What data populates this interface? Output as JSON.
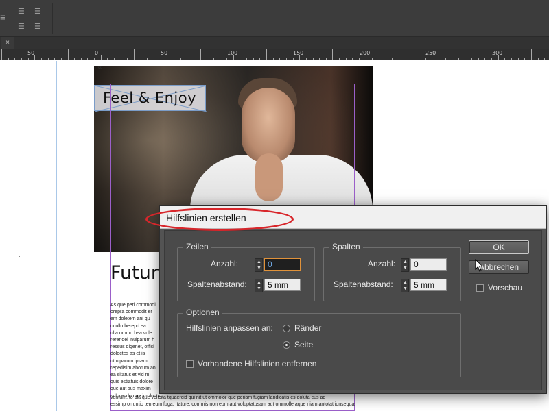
{
  "ruler": {
    "labels": [
      "50",
      "0",
      "50",
      "100",
      "150",
      "200",
      "250",
      "300"
    ]
  },
  "tab": {
    "close_glyph": "×"
  },
  "document": {
    "headline": "Feel & Enjoy",
    "subheading": "Future",
    "body_lines": [
      "As que peri commodi",
      "orepra commodit er",
      "em doletem ani qu",
      "ocullo berepd ea",
      "ulla ommo bea vole",
      "rerendel inulparum h",
      "ressus digenet, offici",
      "doloctes as et is",
      "ut ulparum ipsam",
      "repedisim aborum an",
      "ea sitatus et vid m",
      "quis estiatuis dolore",
      "que aut sus maxim",
      "solorendo que imoluptu",
      "ventum, to bla que velicita tquaercid qui nit ut ommolor que periam fugiam landicatis es doluta cus ad",
      "essimp orruntio ten eum fuga. Itature, commis non eum aut voluptatusam aut ommolle aque niam antotat ionsequas aut dolestio. Itas"
    ]
  },
  "dialog": {
    "title": "Hilfslinien erstellen",
    "rows_group": {
      "title": "Zeilen",
      "count_label": "Anzahl:",
      "count_value": "0",
      "gutter_label": "Spaltenabstand:",
      "gutter_value": "5 mm"
    },
    "columns_group": {
      "title": "Spalten",
      "count_label": "Anzahl:",
      "count_value": "0",
      "gutter_label": "Spaltenabstand:",
      "gutter_value": "5 mm"
    },
    "options_group": {
      "title": "Optionen",
      "fit_label": "Hilfslinien anpassen an:",
      "radio_margins": "Ränder",
      "radio_page": "Seite",
      "selected": "Seite",
      "remove_existing_label": "Vorhandene Hilfslinien entfernen",
      "remove_existing_checked": false
    },
    "ok_label": "OK",
    "cancel_label": "Abbrechen",
    "preview_label": "Vorschau",
    "preview_checked": false
  },
  "colors": {
    "highlight": "#d8262b",
    "frame": "#9b5fc9",
    "focus_border": "#e0923a"
  }
}
